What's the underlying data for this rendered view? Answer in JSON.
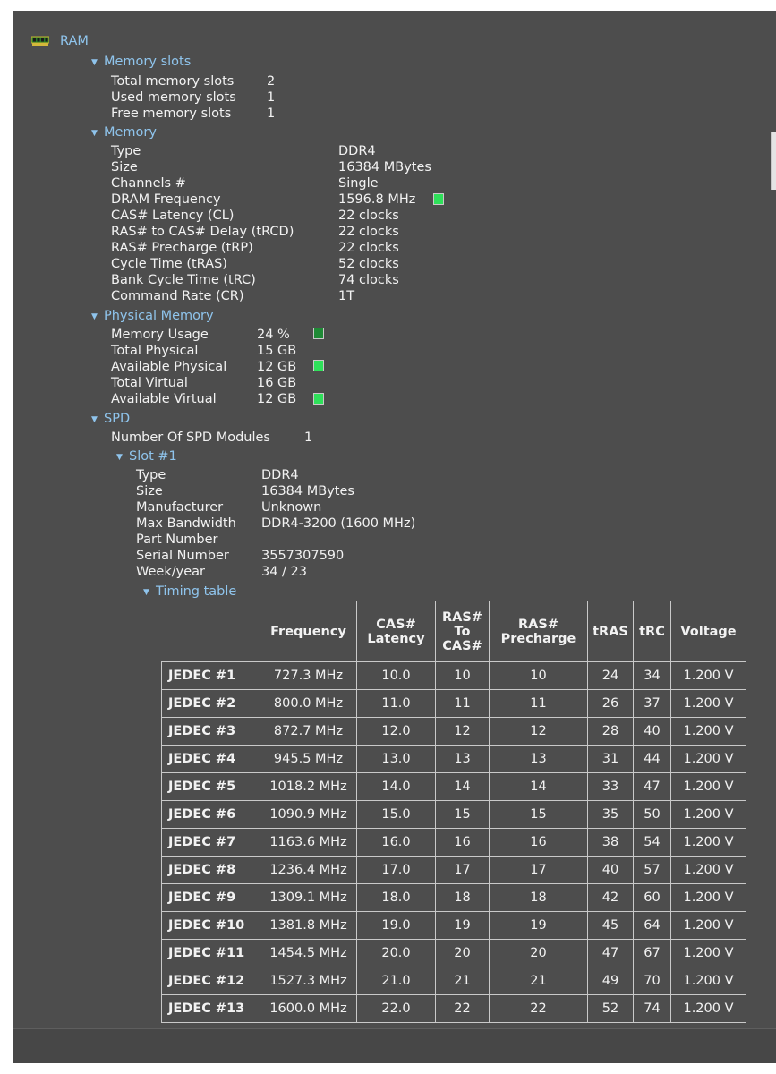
{
  "root": {
    "label": "RAM",
    "icon": "ram-chip-icon"
  },
  "memory_slots": {
    "header": "Memory slots",
    "rows": [
      {
        "label": "Total memory slots",
        "value": "2"
      },
      {
        "label": "Used memory slots",
        "value": "1"
      },
      {
        "label": "Free memory slots",
        "value": "1"
      }
    ]
  },
  "memory": {
    "header": "Memory",
    "rows": [
      {
        "label": "Type",
        "value": "DDR4"
      },
      {
        "label": "Size",
        "value": "16384 MBytes"
      },
      {
        "label": "Channels #",
        "value": "Single"
      },
      {
        "label": "DRAM Frequency",
        "value": "1596.8 MHz"
      },
      {
        "label": "CAS# Latency (CL)",
        "value": "22 clocks"
      },
      {
        "label": "RAS# to CAS# Delay (tRCD)",
        "value": "22 clocks"
      },
      {
        "label": "RAS# Precharge (tRP)",
        "value": "22 clocks"
      },
      {
        "label": "Cycle Time (tRAS)",
        "value": "52 clocks"
      },
      {
        "label": "Bank Cycle Time (tRC)",
        "value": "74 clocks"
      },
      {
        "label": "Command Rate (CR)",
        "value": "1T"
      }
    ]
  },
  "physical_memory": {
    "header": "Physical Memory",
    "rows": [
      {
        "label": "Memory Usage",
        "value": "24 %"
      },
      {
        "label": "Total Physical",
        "value": "15 GB"
      },
      {
        "label": "Available Physical",
        "value": "12 GB"
      },
      {
        "label": "Total Virtual",
        "value": "16 GB"
      },
      {
        "label": "Available Virtual",
        "value": "12 GB"
      }
    ]
  },
  "spd": {
    "header": "SPD",
    "modules": {
      "label": "Number Of SPD Modules",
      "value": "1"
    },
    "slot_header": "Slot #1",
    "rows": [
      {
        "label": "Type",
        "value": "DDR4"
      },
      {
        "label": "Size",
        "value": "16384 MBytes"
      },
      {
        "label": "Manufacturer",
        "value": "Unknown"
      },
      {
        "label": "Max Bandwidth",
        "value": "DDR4-3200 (1600 MHz)"
      },
      {
        "label": "Part Number",
        "value": ""
      },
      {
        "label": "Serial Number",
        "value": "3557307590"
      },
      {
        "label": "Week/year",
        "value": "34 / 23"
      }
    ],
    "timing_header": "Timing table"
  },
  "indicator_colors": {
    "bright": "#2fe05a",
    "dark": "#1f8a36"
  },
  "timing_table": {
    "columns": [
      "Frequency",
      "CAS# Latency",
      "RAS# To CAS#",
      "RAS# Precharge",
      "tRAS",
      "tRC",
      "Voltage"
    ],
    "rows": [
      {
        "name": "JEDEC #1",
        "cells": [
          "727.3 MHz",
          "10.0",
          "10",
          "10",
          "24",
          "34",
          "1.200 V"
        ]
      },
      {
        "name": "JEDEC #2",
        "cells": [
          "800.0 MHz",
          "11.0",
          "11",
          "11",
          "26",
          "37",
          "1.200 V"
        ]
      },
      {
        "name": "JEDEC #3",
        "cells": [
          "872.7 MHz",
          "12.0",
          "12",
          "12",
          "28",
          "40",
          "1.200 V"
        ]
      },
      {
        "name": "JEDEC #4",
        "cells": [
          "945.5 MHz",
          "13.0",
          "13",
          "13",
          "31",
          "44",
          "1.200 V"
        ]
      },
      {
        "name": "JEDEC #5",
        "cells": [
          "1018.2 MHz",
          "14.0",
          "14",
          "14",
          "33",
          "47",
          "1.200 V"
        ]
      },
      {
        "name": "JEDEC #6",
        "cells": [
          "1090.9 MHz",
          "15.0",
          "15",
          "15",
          "35",
          "50",
          "1.200 V"
        ]
      },
      {
        "name": "JEDEC #7",
        "cells": [
          "1163.6 MHz",
          "16.0",
          "16",
          "16",
          "38",
          "54",
          "1.200 V"
        ]
      },
      {
        "name": "JEDEC #8",
        "cells": [
          "1236.4 MHz",
          "17.0",
          "17",
          "17",
          "40",
          "57",
          "1.200 V"
        ]
      },
      {
        "name": "JEDEC #9",
        "cells": [
          "1309.1 MHz",
          "18.0",
          "18",
          "18",
          "42",
          "60",
          "1.200 V"
        ]
      },
      {
        "name": "JEDEC #10",
        "cells": [
          "1381.8 MHz",
          "19.0",
          "19",
          "19",
          "45",
          "64",
          "1.200 V"
        ]
      },
      {
        "name": "JEDEC #11",
        "cells": [
          "1454.5 MHz",
          "20.0",
          "20",
          "20",
          "47",
          "67",
          "1.200 V"
        ]
      },
      {
        "name": "JEDEC #12",
        "cells": [
          "1527.3 MHz",
          "21.0",
          "21",
          "21",
          "49",
          "70",
          "1.200 V"
        ]
      },
      {
        "name": "JEDEC #13",
        "cells": [
          "1600.0 MHz",
          "22.0",
          "22",
          "22",
          "52",
          "74",
          "1.200 V"
        ]
      }
    ]
  }
}
